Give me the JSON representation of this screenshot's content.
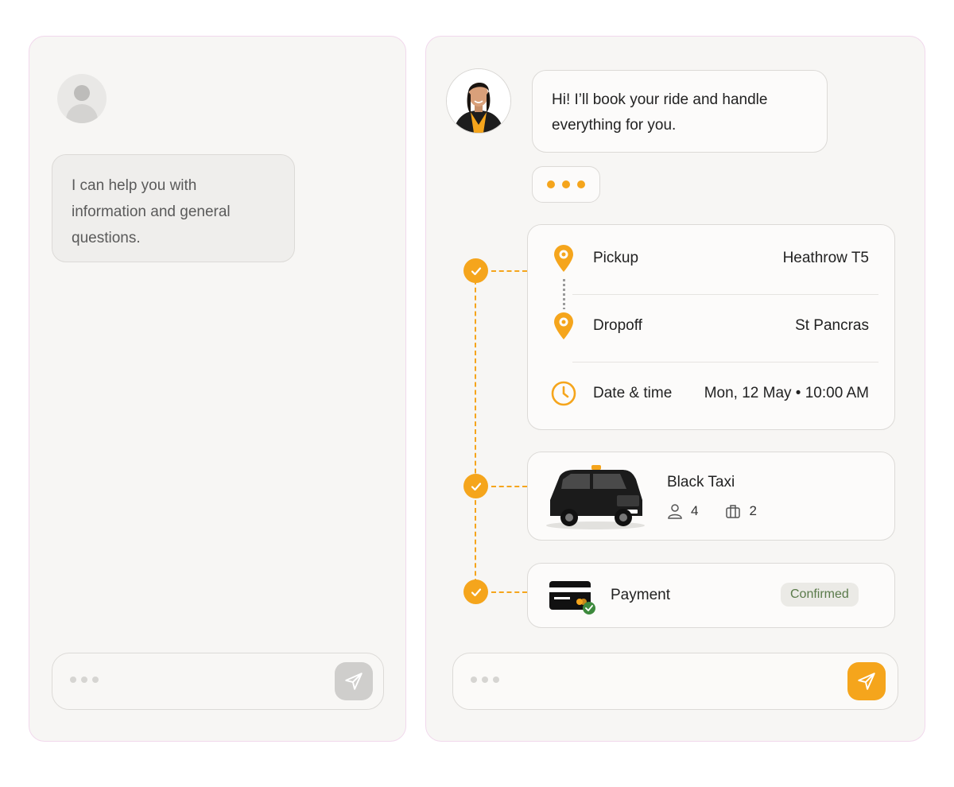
{
  "left_panel": {
    "message": "I can help you with information and general questions.",
    "composer": {
      "send_icon": "send-icon"
    }
  },
  "right_panel": {
    "agent_message": "Hi!  I’ll book your ride and handle everything for you.",
    "trip": {
      "pickup_label": "Pickup",
      "pickup_value": "Heathrow T5",
      "dropoff_label": "Dropoff",
      "dropoff_value": "St Pancras",
      "datetime_label": "Date & time",
      "datetime_value": "Mon, 12 May • 10:00 AM"
    },
    "vehicle": {
      "name": "Black Taxi",
      "passengers": "4",
      "luggage": "2"
    },
    "payment": {
      "label": "Payment",
      "status": "Confirmed"
    },
    "composer": {
      "send_icon": "send-icon"
    }
  },
  "colors": {
    "accent": "#f5a51c",
    "panel_bg": "#f7f6f4",
    "border": "#dcdad7",
    "confirmed_text": "#5a7a4a",
    "confirmed_bg": "#ebeae6"
  }
}
